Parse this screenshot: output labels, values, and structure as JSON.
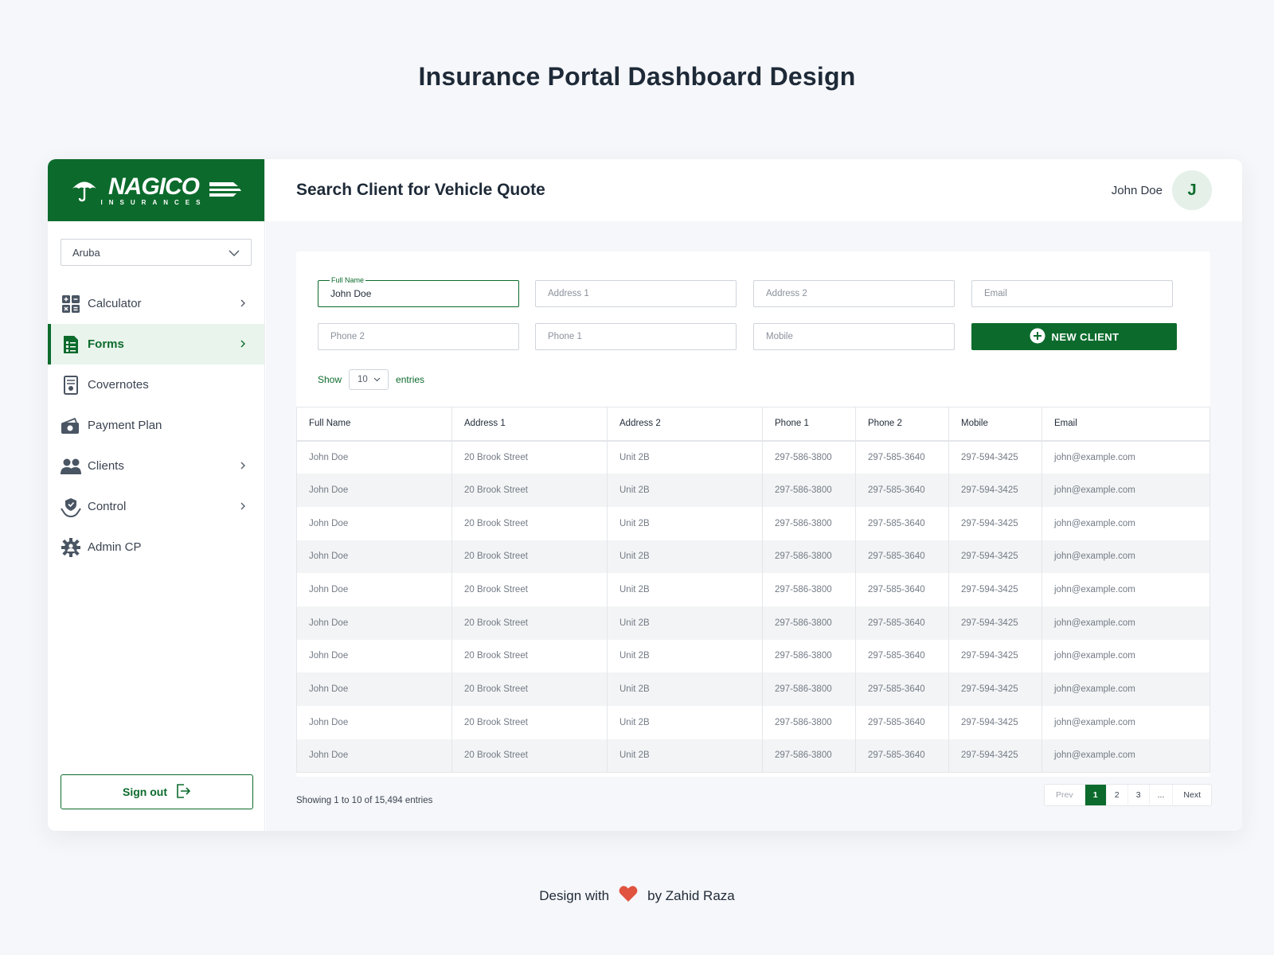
{
  "page_title": "Insurance Portal Dashboard Design",
  "brand": {
    "name": "NAGICO",
    "sub": "INSURANCES",
    "color": "#0c6b2c"
  },
  "sidebar": {
    "country": "Aruba",
    "items": [
      {
        "label": "Calculator",
        "icon": "calculator-icon",
        "chevron": true,
        "active": false
      },
      {
        "label": "Forms",
        "icon": "forms-icon",
        "chevron": true,
        "active": true
      },
      {
        "label": "Covernotes",
        "icon": "covernotes-icon",
        "chevron": false,
        "active": false
      },
      {
        "label": "Payment Plan",
        "icon": "payment-plan-icon",
        "chevron": false,
        "active": false
      },
      {
        "label": "Clients",
        "icon": "clients-icon",
        "chevron": true,
        "active": false
      },
      {
        "label": "Control",
        "icon": "control-icon",
        "chevron": true,
        "active": false
      },
      {
        "label": "Admin CP",
        "icon": "admin-gear-icon",
        "chevron": false,
        "active": false
      }
    ],
    "sign_out": "Sign out"
  },
  "header": {
    "title": "Search Client for Vehicle Quote",
    "user_name": "John Doe",
    "avatar_initial": "J"
  },
  "search": {
    "full_name_label": "Full Name",
    "full_name_value": "John Doe",
    "address1_placeholder": "Address 1",
    "address2_placeholder": "Address 2",
    "email_placeholder": "Email",
    "phone2_placeholder": "Phone 2",
    "phone1_placeholder": "Phone 1",
    "mobile_placeholder": "Mobile",
    "new_client_label": "NEW CLIENT"
  },
  "entries": {
    "show": "Show",
    "value": "10",
    "suffix": "entries"
  },
  "table": {
    "columns": [
      "Full Name",
      "Address 1",
      "Address 2",
      "Phone 1",
      "Phone 2",
      "Mobile",
      "Email"
    ],
    "rows": [
      [
        "John Doe",
        "20 Brook Street",
        "Unit 2B",
        "297-586-3800",
        "297-585-3640",
        "297-594-3425",
        "john@example.com"
      ],
      [
        "John Doe",
        "20 Brook Street",
        "Unit 2B",
        "297-586-3800",
        "297-585-3640",
        "297-594-3425",
        "john@example.com"
      ],
      [
        "John Doe",
        "20 Brook Street",
        "Unit 2B",
        "297-586-3800",
        "297-585-3640",
        "297-594-3425",
        "john@example.com"
      ],
      [
        "John Doe",
        "20 Brook Street",
        "Unit 2B",
        "297-586-3800",
        "297-585-3640",
        "297-594-3425",
        "john@example.com"
      ],
      [
        "John Doe",
        "20 Brook Street",
        "Unit 2B",
        "297-586-3800",
        "297-585-3640",
        "297-594-3425",
        "john@example.com"
      ],
      [
        "John Doe",
        "20 Brook Street",
        "Unit 2B",
        "297-586-3800",
        "297-585-3640",
        "297-594-3425",
        "john@example.com"
      ],
      [
        "John Doe",
        "20 Brook Street",
        "Unit 2B",
        "297-586-3800",
        "297-585-3640",
        "297-594-3425",
        "john@example.com"
      ],
      [
        "John Doe",
        "20 Brook Street",
        "Unit 2B",
        "297-586-3800",
        "297-585-3640",
        "297-594-3425",
        "john@example.com"
      ],
      [
        "John Doe",
        "20 Brook Street",
        "Unit 2B",
        "297-586-3800",
        "297-585-3640",
        "297-594-3425",
        "john@example.com"
      ],
      [
        "John Doe",
        "20 Brook Street",
        "Unit 2B",
        "297-586-3800",
        "297-585-3640",
        "297-594-3425",
        "john@example.com"
      ]
    ]
  },
  "pagination": {
    "info": "Showing 1 to 10 of 15,494 entries",
    "prev": "Prev",
    "pages": [
      "1",
      "2",
      "3",
      "..."
    ],
    "current": "1",
    "next": "Next"
  },
  "credit": {
    "prefix": "Design with",
    "suffix": "by Zahid Raza",
    "heart_color": "#e0533f"
  }
}
